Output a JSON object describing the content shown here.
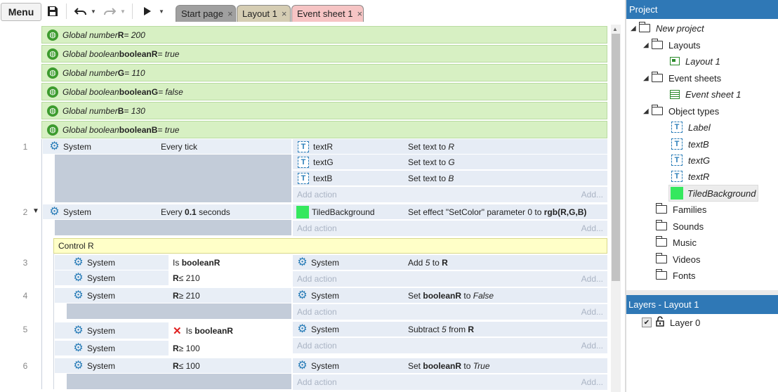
{
  "toolbar": {
    "menu_label": "Menu",
    "tabs": [
      {
        "label": "Start page",
        "close": "×",
        "bg": "#a0a0a0"
      },
      {
        "label": "Layout 1",
        "close": "×",
        "bg": "#d5cdb3"
      },
      {
        "label": "Event sheet 1",
        "close": "×",
        "bg": "#f6c4c4"
      }
    ]
  },
  "globals": [
    {
      "prefix": "Global number ",
      "name": "R",
      "suffix": " = 200"
    },
    {
      "prefix": "Global boolean ",
      "name": "booleanR",
      "suffix": " = true"
    },
    {
      "prefix": "Global number ",
      "name": "G",
      "suffix": " = 110"
    },
    {
      "prefix": "Global boolean ",
      "name": "booleanG",
      "suffix": " = false"
    },
    {
      "prefix": "Global number ",
      "name": "B",
      "suffix": " = 130"
    },
    {
      "prefix": "Global boolean ",
      "name": "booleanB",
      "suffix": " = true"
    }
  ],
  "events": {
    "e1": {
      "num": "1",
      "cond_obj": "System",
      "cond_text": "Every tick",
      "actions": [
        {
          "obj": "textR",
          "pre": "Set text to ",
          "em": "R"
        },
        {
          "obj": "textG",
          "pre": "Set text to ",
          "em": "G"
        },
        {
          "obj": "textB",
          "pre": "Set text to ",
          "em": "B"
        }
      ]
    },
    "e2": {
      "num": "2",
      "cond_obj": "System",
      "cond_pre": "Every ",
      "cond_bold": "0.1",
      "cond_post": " seconds",
      "act_obj": "TiledBackground",
      "act_pre": "Set effect \"SetColor\" parameter 0 to ",
      "act_bold": "rgb(R,G,B)"
    },
    "group_title": "Control R",
    "e3": {
      "num": "3",
      "c1_obj": "System",
      "c1_pre": "Is ",
      "c1_bold": "booleanR",
      "c2_obj": "System",
      "c2_bold": "R",
      "c2_post": " ≤ 210",
      "act_obj": "System",
      "act_pre": "Add ",
      "act_em": "5",
      "act_mid": " to ",
      "act_bold": "R"
    },
    "e4": {
      "num": "4",
      "c1_obj": "System",
      "c1_bold": "R",
      "c1_post": " ≥ 210",
      "act_obj": "System",
      "act_pre": "Set ",
      "act_bold": "booleanR",
      "act_mid": " to ",
      "act_em": "False"
    },
    "e5": {
      "num": "5",
      "c1_obj": "System",
      "c1_pre": "Is ",
      "c1_bold": "booleanR",
      "c2_obj": "System",
      "c2_bold": "R",
      "c2_post": " ≥ 100",
      "act_obj": "System",
      "act_pre": "Subtract ",
      "act_em": "5",
      "act_mid": " from ",
      "act_bold": "R"
    },
    "e6": {
      "num": "6",
      "c1_obj": "System",
      "c1_bold": "R",
      "c1_post": " ≤ 100",
      "act_obj": "System",
      "act_pre": "Set ",
      "act_bold": "booleanR",
      "act_mid": " to ",
      "act_em": "True"
    },
    "add_action": "Add action",
    "add_short": "Add..."
  },
  "project": {
    "header": "Project",
    "root": "New project",
    "layouts": "Layouts",
    "layout1": "Layout 1",
    "event_sheets": "Event sheets",
    "event_sheet1": "Event sheet 1",
    "object_types": "Object types",
    "objects": [
      "Label",
      "textB",
      "textG",
      "textR",
      "TiledBackground"
    ],
    "families": "Families",
    "sounds": "Sounds",
    "music": "Music",
    "videos": "Videos",
    "fonts": "Fonts"
  },
  "layers": {
    "header": "Layers - Layout 1",
    "layer0": "Layer 0"
  },
  "colors": {
    "accent": "#2f78b6",
    "global_bg": "#d7f0c3",
    "group_bg": "#ffffc8",
    "tile_green": "#35e85e"
  }
}
